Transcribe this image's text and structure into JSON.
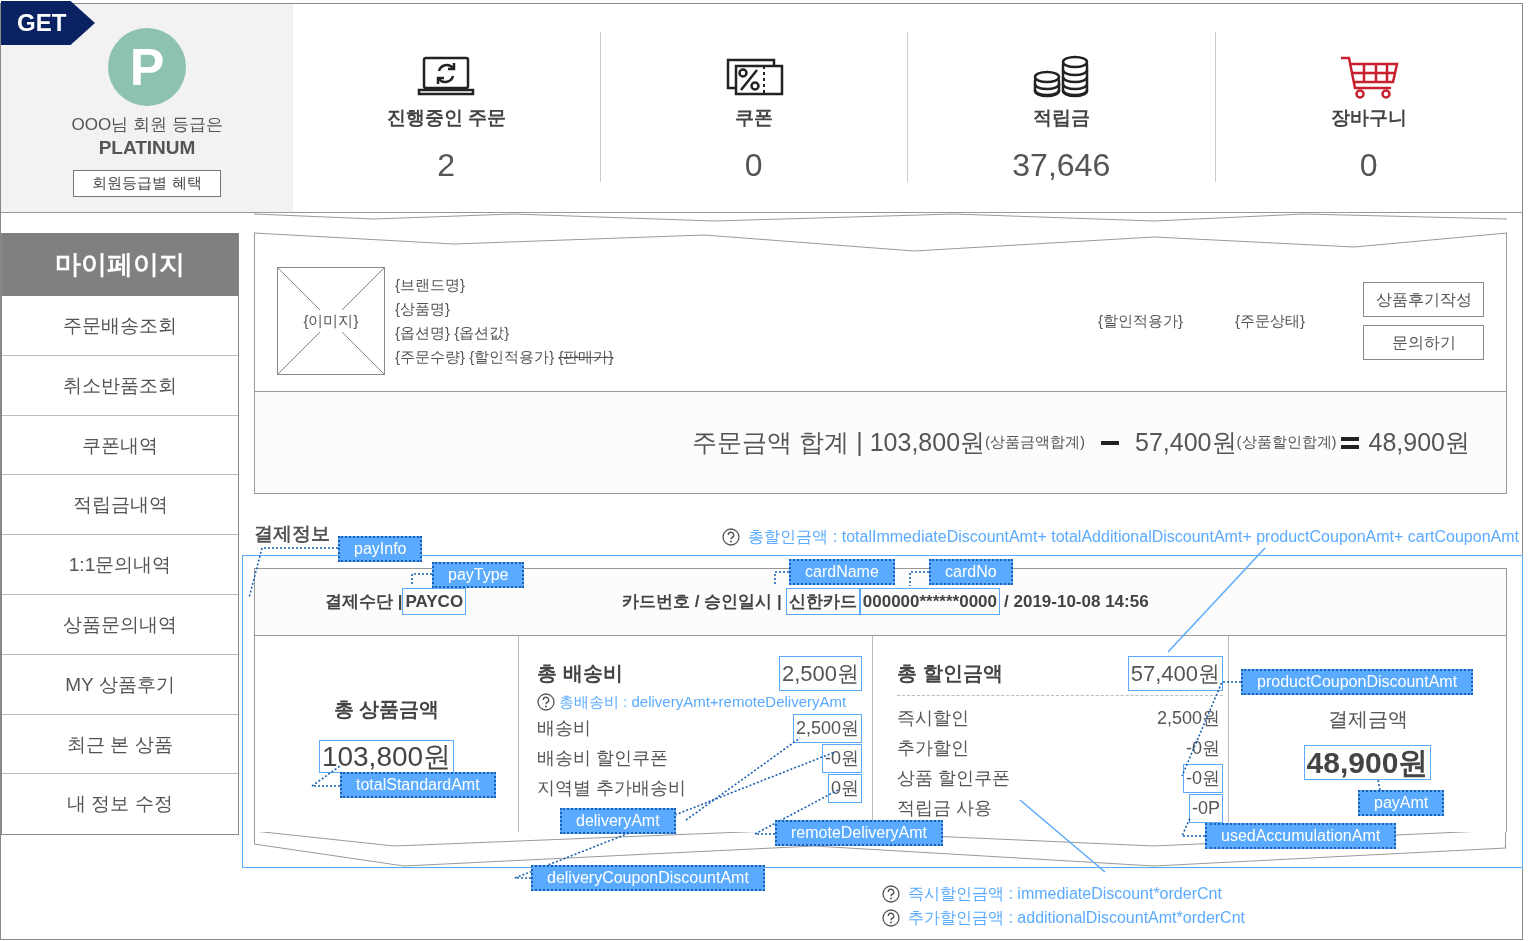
{
  "badge": "GET",
  "member": {
    "greeting": "OOO님 회원 등급은",
    "grade": "PLATINUM",
    "grade_letter": "P",
    "benefits_button": "회원등급별 혜택"
  },
  "stats": [
    {
      "kind": "orders",
      "label": "진행중인 주문",
      "value": "2"
    },
    {
      "kind": "coupon",
      "label": "쿠폰",
      "value": "0"
    },
    {
      "kind": "points",
      "label": "적립금",
      "value": "37,646"
    },
    {
      "kind": "cart",
      "label": "장바구니",
      "value": "0"
    }
  ],
  "sidebar": {
    "title": "마이페이지",
    "items": [
      "주문배송조회",
      "취소반품조회",
      "쿠폰내역",
      "적립금내역",
      "1:1문의내역",
      "상품문의내역",
      "MY 상품후기",
      "최근 본 상품",
      "내 정보 수정"
    ]
  },
  "order_item": {
    "image_label": "{이미지}",
    "lines": [
      "{브랜드명}",
      "{상품명}",
      "{옵션명} {옵션값}"
    ],
    "qty_line": [
      {
        "text": "{주문수량}",
        "struck": false
      },
      {
        "text": "{할인적용가}",
        "struck": false
      },
      {
        "text": "{판매가}",
        "struck": true
      }
    ],
    "discount_price": "{할인적용가}",
    "status": "{주문상태}",
    "buttons": [
      "상품후기작성",
      "문의하기"
    ]
  },
  "order_total": {
    "label": "주문금액 합계 | 103,800원",
    "label_note": "(상품금액합계)",
    "discount": "57,400원",
    "discount_note": "(상품할인합계)",
    "total": "48,900원"
  },
  "payment": {
    "title": "결제정보",
    "discount_formula": "총할인금액 : totalImmediateDiscountAmt+ totalAdditionalDiscountAmt+ productCouponAmt+ cartCouponAmt",
    "method": {
      "label": "결제수단 |",
      "value": "PAYCO",
      "boxed": true
    },
    "card": {
      "label": "카드번호 / 승인일시 |",
      "name": "신한카드",
      "name_boxed": true,
      "number": "000000******0000",
      "number_boxed": true,
      "approved": "/ 2019-10-08 14:56"
    },
    "product_total": {
      "title": "총 상품금액",
      "value": "103,800원",
      "boxed": true
    },
    "delivery": {
      "title": "총 배송비",
      "value": "2,500원",
      "boxed": true,
      "formula": "총배송비 : deliveryAmt+remoteDeliveryAmt",
      "rows": [
        {
          "label": "배송비",
          "value": "2,500원",
          "boxed": true
        },
        {
          "label": "배송비 할인쿠폰",
          "value": "-0원",
          "boxed": true
        },
        {
          "label": "지역별 추가배송비",
          "value": "0원",
          "boxed": true
        }
      ]
    },
    "discount": {
      "title": "총 할인금액",
      "value": "57,400원",
      "boxed": true,
      "rows": [
        {
          "label": "즉시할인",
          "value": "2,500원",
          "boxed": false
        },
        {
          "label": "추가할인",
          "value": "-0원",
          "boxed": false
        },
        {
          "label": "상품 할인쿠폰",
          "value": "-0원",
          "boxed": true
        },
        {
          "label": "적립금 사용",
          "value": "-0P",
          "boxed": true
        }
      ]
    },
    "pay_amount": {
      "title": "결제금액",
      "value": "48,900원",
      "boxed": true
    }
  },
  "annotation_tags": [
    "payInfo",
    "payType",
    "cardName",
    "cardNo",
    "productCouponDiscountAmt",
    "deliveryAmt",
    "payAmt",
    "totalStandardAmt",
    "remoteDeliveryAmt",
    "usedAccumulationAmt",
    "deliveryCouponDiscountAmt"
  ],
  "formula_notes": [
    "즉시할인금액 : immediateDiscount*orderCnt",
    "추가할인금액 : additionalDiscountAmt*orderCnt"
  ]
}
